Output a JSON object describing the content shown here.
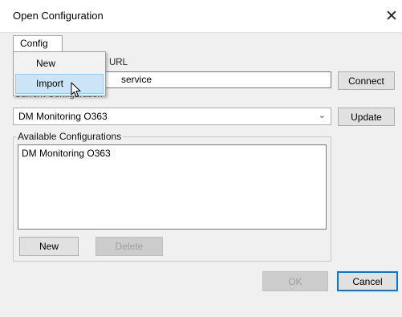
{
  "window": {
    "title": "Open Configuration",
    "close_glyph": "✕"
  },
  "menubar": {
    "config_label": "Config",
    "dropdown_items": [
      "New",
      "Import"
    ],
    "hovered_item": "Import"
  },
  "url_section": {
    "label_fragment": "URL",
    "value_fragment": "service",
    "connect_label": "Connect"
  },
  "current_configuration": {
    "label": "Current Configuration",
    "selected": "DM Monitoring O363",
    "update_label": "Update"
  },
  "available_configurations": {
    "legend": "Available Configurations",
    "items": [
      "DM Monitoring O363"
    ],
    "new_label": "New",
    "delete_label": "Delete"
  },
  "footer": {
    "ok_label": "OK",
    "cancel_label": "Cancel"
  },
  "icons": {
    "close": "close-icon",
    "dropdown_arrow": "chevron-down-icon",
    "cursor": "mouse-pointer-icon"
  },
  "colors": {
    "hover_bg": "#cce4f7",
    "hover_border": "#99c9ef",
    "default_button_border": "#0078d7"
  }
}
